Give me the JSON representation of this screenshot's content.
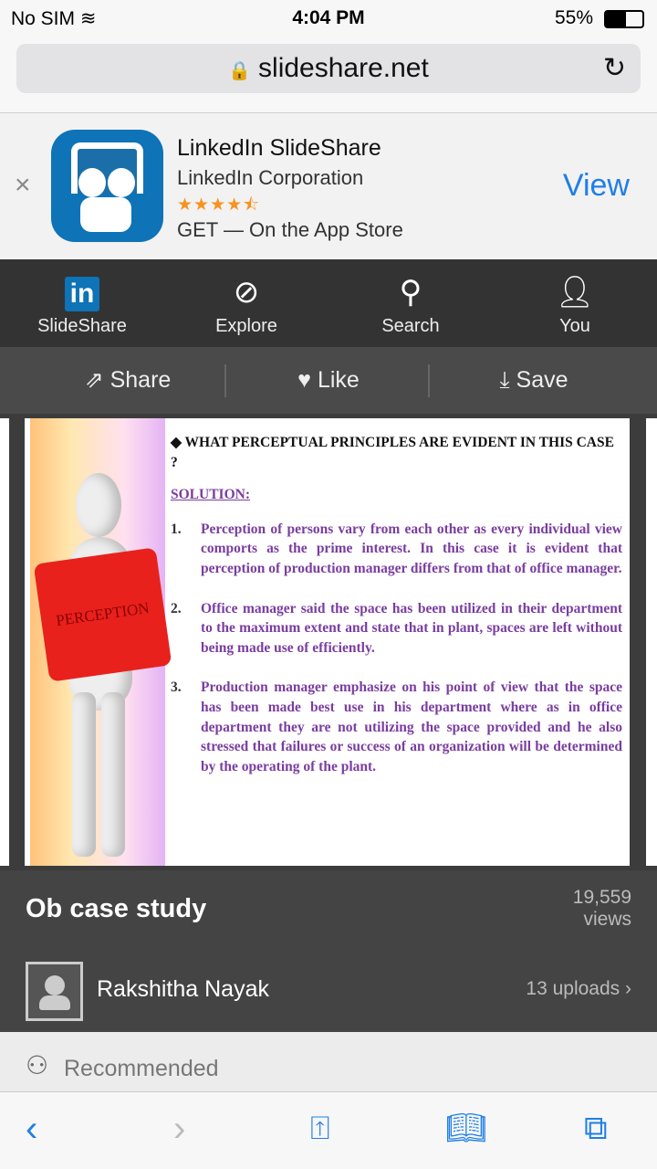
{
  "status": {
    "carrier": "No SIM",
    "time": "4:04 PM",
    "battery": "55%",
    "battery_level": 0.55
  },
  "browser": {
    "url": "slideshare.net"
  },
  "banner": {
    "app_name": "LinkedIn SlideShare",
    "developer": "LinkedIn Corporation",
    "rating": 4.5,
    "stars": "★★★★⯪",
    "cta_text": "GET — On the App Store",
    "view_label": "View",
    "close": "×"
  },
  "nav": {
    "items": [
      {
        "label": "SlideShare"
      },
      {
        "label": "Explore"
      },
      {
        "label": "Search"
      },
      {
        "label": "You"
      }
    ],
    "logo_text": "in"
  },
  "actions": {
    "share": "Share",
    "like": "Like",
    "save": "Save"
  },
  "slide": {
    "image_caption": "PERCEPTION",
    "question": "WHAT PERCEPTUAL PRINCIPLES ARE EVIDENT IN THIS CASE ?",
    "solution_label": "SOLUTION:",
    "points": [
      {
        "n": "1.",
        "text": "Perception of persons vary from each other as every individual view comports as the prime interest. In this case it is evident that perception of production manager differs from that of office manager."
      },
      {
        "n": "2.",
        "text": "Office manager said the space has been utilized in their department to the maximum extent and state that in plant, spaces are left without being made use of efficiently."
      },
      {
        "n": "3.",
        "text": "Production manager emphasize on his point of view that the space has been made best use in his department where as in office department they are not utilizing the space provided and he also stressed that failures or success of an organization will be determined by the operating of the plant."
      }
    ]
  },
  "info": {
    "title": "Ob case study",
    "views_count": "19,559",
    "views_label": "views",
    "author": "Rakshitha Nayak",
    "uploads": "13 uploads"
  },
  "recommended": {
    "label": "Recommended"
  },
  "colors": {
    "accent": "#1f7fe5",
    "linkedin": "#0e73b7",
    "slide_text": "#7a3da0"
  }
}
